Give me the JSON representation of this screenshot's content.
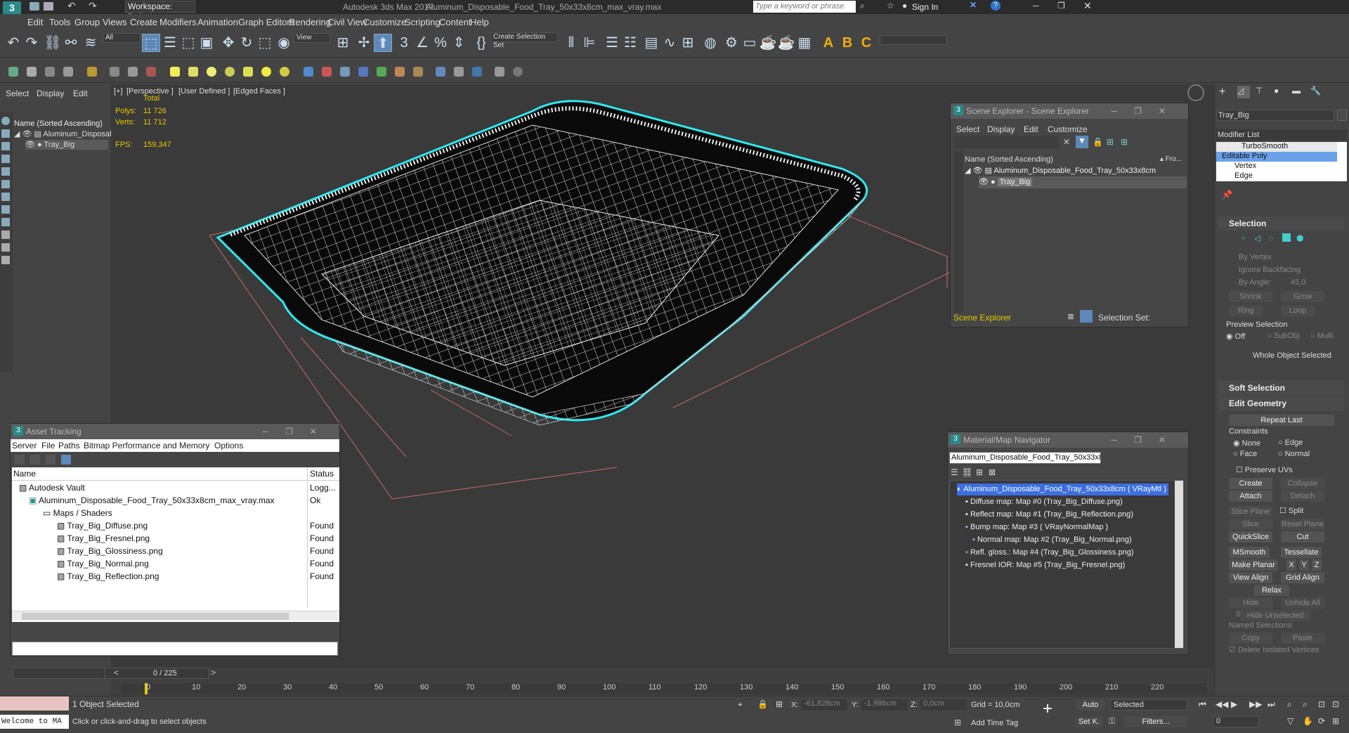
{
  "title": {
    "workspace": "Workspace: Default",
    "app": "Autodesk 3ds Max 2017",
    "file": "Aluminum_Disposable_Food_Tray_50x33x8cm_max_vray.max",
    "search_placeholder": "Type a keyword or phrase",
    "sign_in": "Sign In"
  },
  "menu": [
    "Edit",
    "Tools",
    "Group",
    "Views",
    "Create",
    "Modifiers",
    "Animation",
    "Graph Editors",
    "Rendering",
    "Civil View",
    "Customize",
    "Scripting",
    "Content",
    "Help"
  ],
  "toolbar": {
    "filter": "All",
    "view": "View",
    "selection_set": "Create Selection Set"
  },
  "scene_panel": {
    "tabs": [
      "Select",
      "Display",
      "Edit"
    ],
    "column": "Name (Sorted Ascending)",
    "items": [
      "Aluminum_Disposab",
      "Tray_Big"
    ]
  },
  "viewport": {
    "labels": [
      "[+]",
      "[Perspective ]",
      "[User Defined ]",
      "[Edged Faces ]"
    ],
    "stats_total": "Total",
    "polys_label": "Polys:",
    "polys_value": "11 726",
    "verts_label": "Verts:",
    "verts_value": "11 712",
    "fps_label": "FPS:",
    "fps_value": "159,347"
  },
  "scene_explorer": {
    "title": "Scene Explorer - Scene Explorer",
    "menu": [
      "Select",
      "Display",
      "Edit",
      "Customize"
    ],
    "column": "Name (Sorted Ascending)",
    "column2": "▴ Fro...",
    "items": [
      "Aluminum_Disposable_Food_Tray_50x33x8cm",
      "Tray_Big"
    ],
    "footer": "Scene Explorer",
    "selection_set": "Selection Set:"
  },
  "asset_tracking": {
    "title": "Asset Tracking",
    "menu": [
      "Server",
      "File",
      "Paths",
      "Bitmap Performance and Memory",
      "Options"
    ],
    "col_name": "Name",
    "col_status": "Status",
    "rows": [
      {
        "name": "Autodesk Vault",
        "status": "Logg..."
      },
      {
        "name": "Aluminum_Disposable_Food_Tray_50x33x8cm_max_vray.max",
        "status": "Ok"
      },
      {
        "name": "Maps / Shaders",
        "status": ""
      },
      {
        "name": "Tray_Big_Diffuse.png",
        "status": "Found"
      },
      {
        "name": "Tray_Big_Fresnel.png",
        "status": "Found"
      },
      {
        "name": "Tray_Big_Glossiness.png",
        "status": "Found"
      },
      {
        "name": "Tray_Big_Normal.png",
        "status": "Found"
      },
      {
        "name": "Tray_Big_Reflection.png",
        "status": "Found"
      }
    ]
  },
  "material_navigator": {
    "title": "Material/Map Navigator",
    "field": "Aluminum_Disposable_Food_Tray_50x33x8cm",
    "items": [
      "Aluminum_Disposable_Food_Tray_50x33x8cm  ( VRayMtl )",
      "Diffuse map: Map #0 (Tray_Big_Diffuse.png)",
      "Reflect map: Map #1 (Tray_Big_Reflection.png)",
      "Bump map: Map #3  ( VRayNormalMap )",
      "Normal map: Map #2 (Tray_Big_Normal.png)",
      "Refl. gloss.: Map #4 (Tray_Big_Glossiness.png)",
      "Fresnel IOR: Map #5 (Tray_Big_Fresnel.png)"
    ]
  },
  "command_panel": {
    "object_name": "Tray_Big",
    "modifier_list": "Modifier List",
    "stack": [
      "TurboSmooth",
      "Editable Poly",
      "Vertex",
      "Edge"
    ],
    "selection_header": "Selection",
    "by_vertex": "By Vertex",
    "ignore_backfacing": "Ignore Backfacing",
    "by_angle": "By Angle:",
    "angle_value": "45,0",
    "shrink": "Shrink",
    "grow": "Grow",
    "ring": "Ring",
    "loop": "Loop",
    "preview_selection": "Preview Selection",
    "off": "Off",
    "subobj": "SubObj",
    "multi": "Multi",
    "whole_object": "Whole Object Selected",
    "soft_selection": "Soft Selection",
    "edit_geometry": "Edit Geometry",
    "repeat_last": "Repeat Last",
    "constraints": "Constraints",
    "none": "None",
    "edge": "Edge",
    "face": "Face",
    "normal": "Normal",
    "preserve_uvs": "Preserve UVs",
    "create": "Create",
    "collapse": "Collapse",
    "attach": "Attach",
    "detach": "Detach",
    "slice_plane": "Slice Plane",
    "split": "Split",
    "slice": "Slice",
    "reset_plane": "Reset Plane",
    "quickslice": "QuickSlice",
    "cut": "Cut",
    "msmooth": "MSmooth",
    "tessellate": "Tessellate",
    "make_planar": "Make Planar",
    "x": "X",
    "y": "Y",
    "z": "Z",
    "view_align": "View Align",
    "grid_align": "Grid Align",
    "relax": "Relax",
    "hide_selected": "Hide Selected",
    "unhide_all": "Unhide All",
    "hide_unselected": "Hide Unselected",
    "named_selections": "Named Selections:",
    "copy": "Copy",
    "paste": "Paste",
    "delete_isolated": "Delete Isolated Vertices"
  },
  "timeline": {
    "frame": "0 / 225",
    "ticks": [
      "0",
      "10",
      "20",
      "30",
      "40",
      "50",
      "60",
      "70",
      "80",
      "90",
      "100",
      "110",
      "120",
      "130",
      "140",
      "150",
      "160",
      "170",
      "180",
      "190",
      "200",
      "210",
      "220"
    ]
  },
  "status": {
    "maxscript": "Welcome to MA",
    "selected": "1 Object Selected",
    "prompt": "Click or click-and-drag to select objects",
    "x_label": "X:",
    "x_value": "-61,828cm",
    "y_label": "Y:",
    "y_value": "-1,986cm",
    "z_label": "Z:",
    "z_value": "0,0cm",
    "grid": "Grid = 10,0cm",
    "add_time_tag": "Add Time Tag",
    "auto": "Auto",
    "set_k": "Set K.",
    "selected_dd": "Selected",
    "filters": "Filters...",
    "frame_field": "0"
  },
  "colors": {
    "accent": "#5d88b8",
    "highlight": "#2ee8f0",
    "stats": "#e6c700"
  }
}
